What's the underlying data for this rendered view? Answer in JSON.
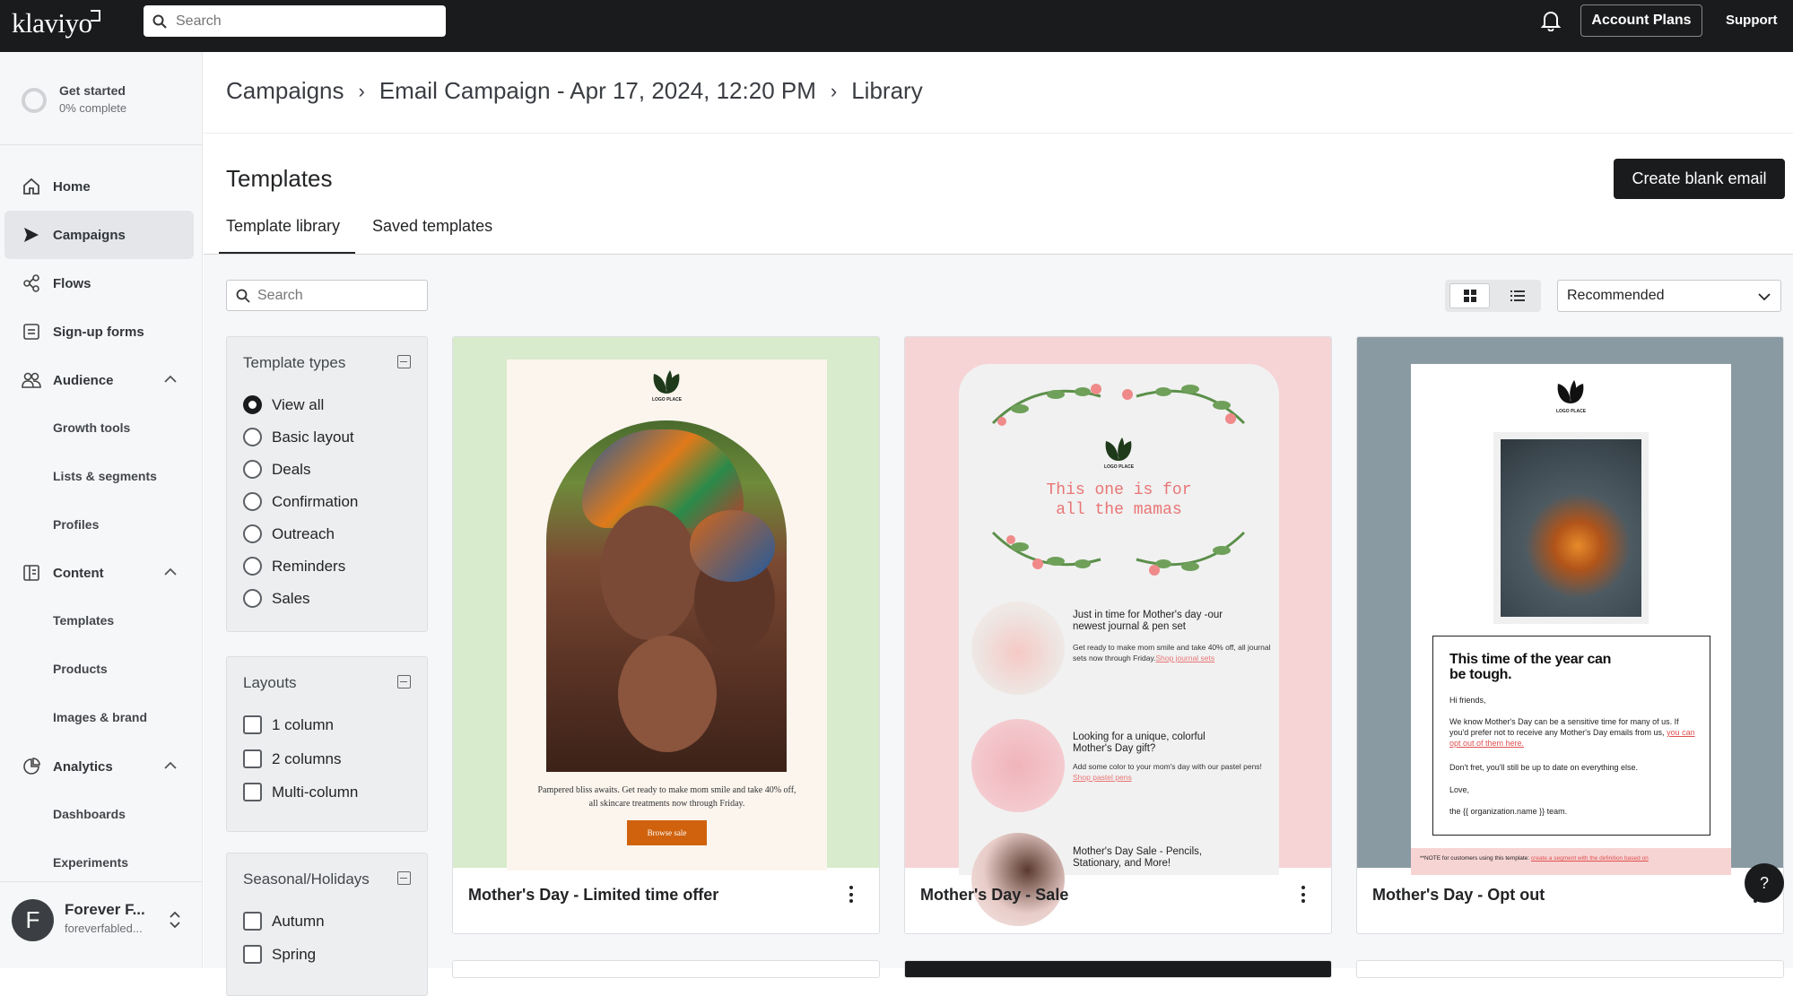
{
  "topbar": {
    "logo_text": "klaviyo",
    "search_placeholder": "Search",
    "account_plans": "Account Plans",
    "support": "Support"
  },
  "sidebar": {
    "get_started": {
      "title": "Get started",
      "progress": "0% complete"
    },
    "items": [
      {
        "label": "Home",
        "icon": "home-icon"
      },
      {
        "label": "Campaigns",
        "icon": "send-icon",
        "active": true
      },
      {
        "label": "Flows",
        "icon": "flows-icon"
      },
      {
        "label": "Sign-up forms",
        "icon": "form-icon"
      },
      {
        "label": "Audience",
        "icon": "audience-icon"
      },
      {
        "label": "Content",
        "icon": "content-icon"
      },
      {
        "label": "Analytics",
        "icon": "analytics-icon"
      }
    ],
    "audience_sub": [
      "Growth tools",
      "Lists & segments",
      "Profiles"
    ],
    "content_sub": [
      "Templates",
      "Products",
      "Images & brand"
    ],
    "analytics_sub": [
      "Dashboards",
      "Experiments"
    ],
    "user": {
      "initial": "F",
      "name": "Forever F...",
      "email": "foreverfabled..."
    }
  },
  "breadcrumb": [
    "Campaigns",
    "Email Campaign - Apr 17, 2024, 12:20 PM",
    "Library"
  ],
  "page": {
    "title": "Templates",
    "create_button": "Create blank email",
    "tabs": [
      "Template library",
      "Saved templates"
    ]
  },
  "library": {
    "search_placeholder": "Search",
    "sort_selected": "Recommended"
  },
  "filters": {
    "template_types": {
      "title": "Template types",
      "options": [
        "View all",
        "Basic layout",
        "Deals",
        "Confirmation",
        "Outreach",
        "Reminders",
        "Sales"
      ],
      "selected": "View all"
    },
    "layouts": {
      "title": "Layouts",
      "options": [
        "1 column",
        "2 columns",
        "Multi-column"
      ]
    },
    "seasonal": {
      "title": "Seasonal/Holidays",
      "options": [
        "Autumn",
        "Spring"
      ]
    }
  },
  "cards": [
    {
      "name": "Mother's Day - Limited time offer",
      "logo": "LOGO PLACE",
      "body": "Pampered bliss awaits. Get ready to make mom smile and take 40% off, all skincare treatments now through Friday.",
      "cta": "Browse sale",
      "bg": "#d8ebcc"
    },
    {
      "name": "Mother's Day - Sale",
      "logo": "LOGO PLACE",
      "headline": "This one is for all the mamas",
      "item1_title": "Just in time for Mother's day -our newest journal & pen set",
      "item1_body": "Get ready to make mom smile and take 40% off, all journal sets now through Friday.",
      "item1_link": "Shop journal sets",
      "item2_title": "Looking for a unique, colorful Mother's Day gift?",
      "item2_body": "Add some color to your mom's day with our pastel pens!",
      "item2_link": "Shop pastel pens",
      "item3_title": "Mother's Day Sale - Pencils, Stationary, and More!",
      "bg": "#f6d4d6"
    },
    {
      "name": "Mother's Day - Opt out",
      "logo": "LOGO PLACE",
      "headline": "This time of the year can be tough.",
      "greeting": "Hi friends,",
      "para1": "We know Mother's Day can be a sensitive time for many of us. If you'd prefer not to receive any Mother's Day emails from us,",
      "para1_link": "you can opt out of them here.",
      "para2": "Don't fret, you'll still be up to date on everything else.",
      "signoff": "Love,",
      "team": "the {{ organization.name }} team.",
      "note": "**NOTE for customers using this template:",
      "note_link": "create a segment with the definition based on",
      "bg": "#8a9aa3"
    }
  ],
  "help_label": "?"
}
